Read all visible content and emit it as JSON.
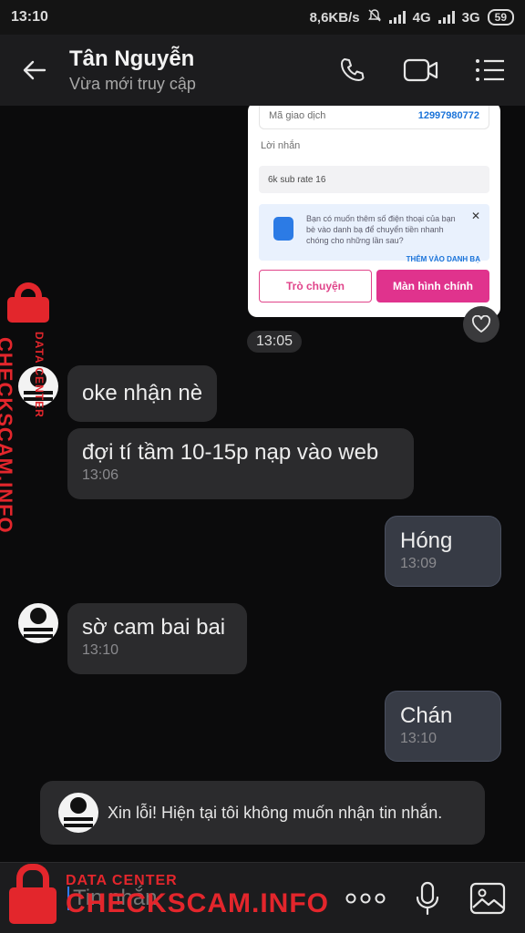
{
  "status_bar": {
    "time": "13:10",
    "speed": "8,6KB/s",
    "network1": "4G",
    "network2": "3G",
    "battery": "59"
  },
  "header": {
    "contact_name": "Tân Nguyễn",
    "last_seen": "Vừa mới truy cập"
  },
  "shared_screenshot": {
    "transaction_label": "Mã giao dịch",
    "transaction_value": "12997980772",
    "message_label": "Lời nhắn",
    "message_value": "6k sub rate 16",
    "banner_text": "Bạn có muốn thêm số điện thoại của bạn bè vào danh bạ để chuyển tiền nhanh chóng cho những lần sau?",
    "banner_link": "THÊM VÀO DANH BẠ",
    "chat_button": "Trò chuyện",
    "main_button": "Màn hình chính"
  },
  "time_pill": "13:05",
  "messages": [
    {
      "text": "oke nhận nè"
    },
    {
      "text": "đợi tí tầm 10-15p nạp vào web",
      "time": "13:06"
    },
    {
      "text": "Hóng",
      "time": "13:09"
    },
    {
      "text": "sờ cam bai bai",
      "time": "13:10"
    },
    {
      "text": "Chán",
      "time": "13:10"
    }
  ],
  "system_notice": "Xin lỗi! Hiện tại tôi không muốn nhận tin nhắn.",
  "composer": {
    "placeholder": "Tin nhắn"
  },
  "watermark": {
    "small": "DATA CENTER",
    "big": "CHECKSCAM.INFO",
    "color": "#e3262c"
  },
  "icons": [
    "back-arrow-icon",
    "phone-icon",
    "video-camera-icon",
    "menu-icon",
    "heart-icon",
    "more-dots-icon",
    "microphone-icon",
    "image-icon"
  ]
}
